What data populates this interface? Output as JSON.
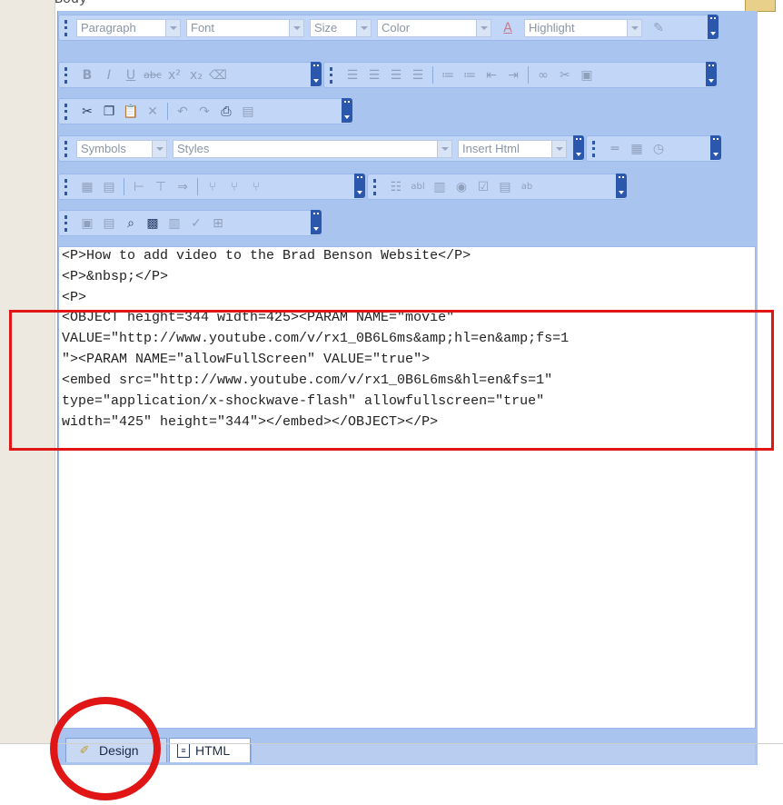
{
  "field_label": "Body",
  "toolbar": {
    "row1": {
      "paragraph": "Paragraph",
      "font": "Font",
      "size": "Size",
      "color": "Color",
      "highlight": "Highlight"
    },
    "row4": {
      "symbols": "Symbols",
      "styles": "Styles",
      "insert_html": "Insert Html"
    }
  },
  "code_lines": [
    "<P>How to add video to the Brad Benson Website</P>",
    "<P>&nbsp;</P>",
    "<P>",
    "<OBJECT height=344 width=425><PARAM NAME=\"movie\"",
    "VALUE=\"http://www.youtube.com/v/rx1_0B6L6ms&amp;hl=en&amp;fs=1",
    "\"><PARAM NAME=\"allowFullScreen\" VALUE=\"true\">",
    "<embed src=\"http://www.youtube.com/v/rx1_0B6L6ms&hl=en&fs=1\"",
    "type=\"application/x-shockwave-flash\" allowfullscreen=\"true\"",
    "width=\"425\" height=\"344\"></embed></OBJECT></P>"
  ],
  "tabs": {
    "design": "Design",
    "html": "HTML"
  },
  "icons": {
    "design_tab": "pencil-ruler-icon",
    "html_tab": "document-icon"
  },
  "annotation_color": "#e01616"
}
